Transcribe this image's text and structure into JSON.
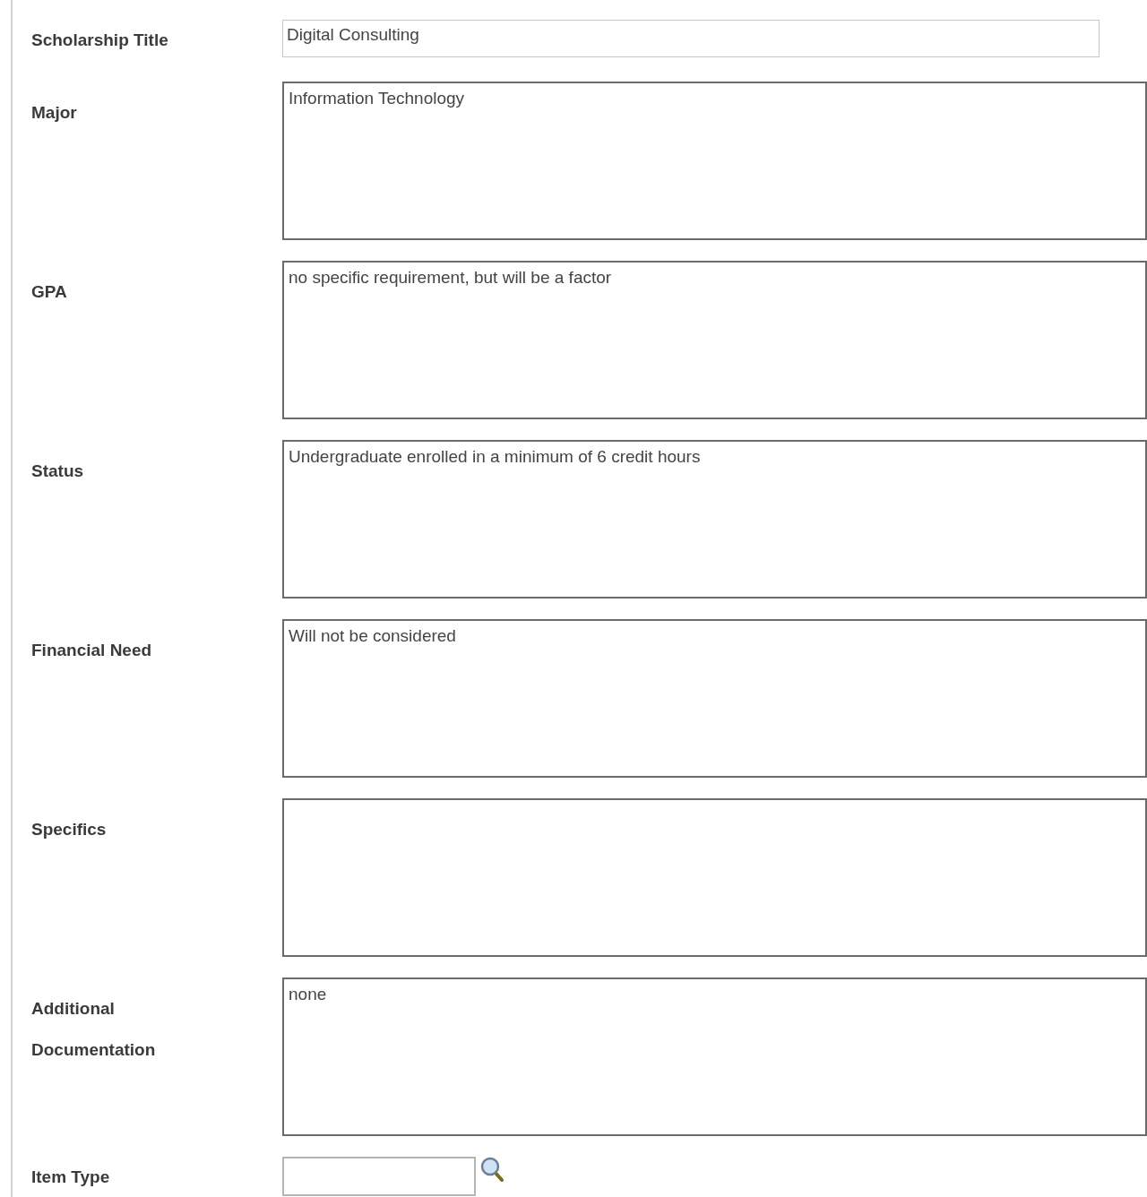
{
  "fields": [
    {
      "label": "Scholarship Title",
      "kind": "text",
      "value": "Digital Consulting"
    },
    {
      "label": "Major",
      "kind": "textarea",
      "value": "Information Technology"
    },
    {
      "label": "GPA",
      "kind": "textarea",
      "value": "no specific requirement, but will be a factor"
    },
    {
      "label": "Status",
      "kind": "textarea",
      "value": "Undergraduate enrolled in a minimum of 6 credit hours"
    },
    {
      "label": "Financial Need",
      "kind": "textarea",
      "value": "Will not be considered"
    },
    {
      "label": "Specifics",
      "kind": "textarea"
    },
    {
      "label": "Additional Documentation",
      "kind": "textarea",
      "value": "none"
    },
    {
      "label": "Item Type",
      "kind": "lookup"
    }
  ]
}
